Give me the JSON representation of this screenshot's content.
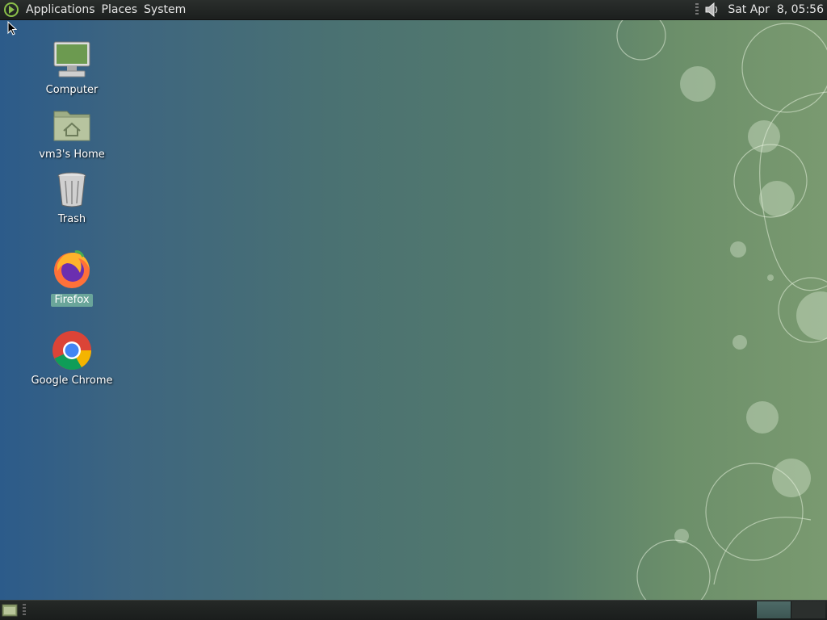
{
  "top_panel": {
    "menus": [
      "Applications",
      "Places",
      "System"
    ],
    "clock": "Sat Apr  8, 05:56"
  },
  "desktop_icons": [
    {
      "label": "Computer",
      "icon": "computer-icon"
    },
    {
      "label": "vm3's Home",
      "icon": "home-folder-icon"
    },
    {
      "label": "Trash",
      "icon": "trash-icon"
    },
    {
      "label": "Firefox",
      "icon": "firefox-icon",
      "selected": true
    },
    {
      "label": "Google Chrome",
      "icon": "chrome-icon"
    }
  ],
  "bottom_panel": {
    "workspaces": 2
  }
}
